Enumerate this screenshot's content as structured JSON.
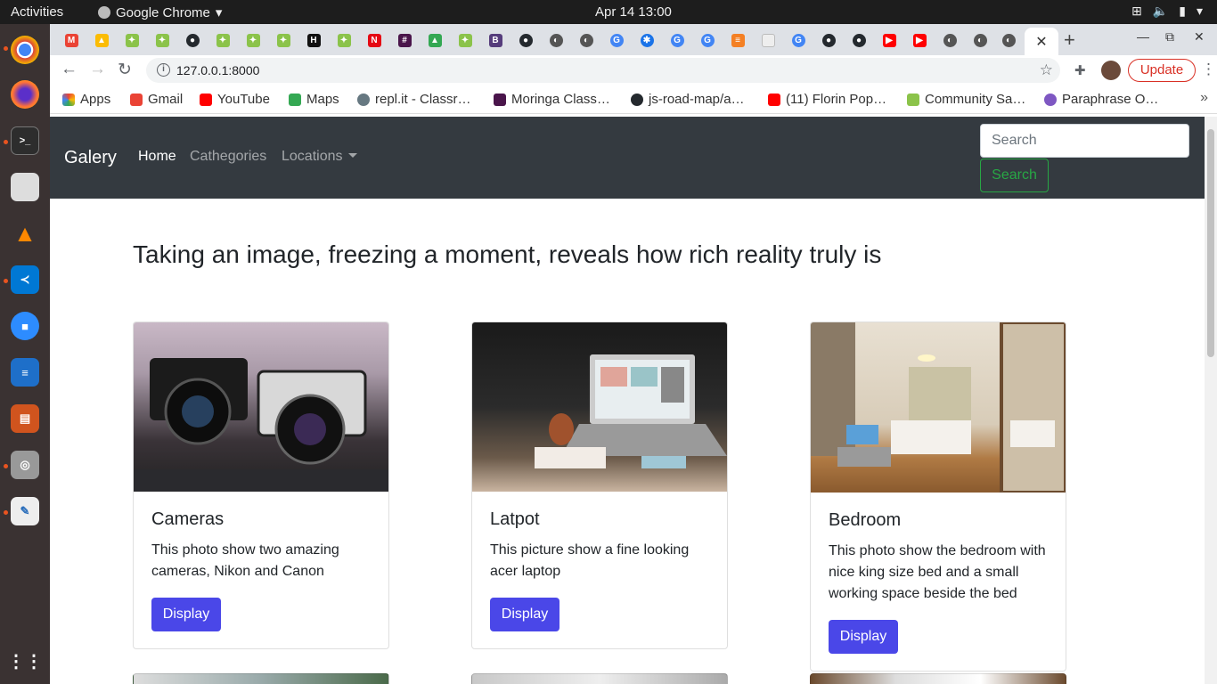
{
  "system": {
    "activities": "Activities",
    "app_name": "Google Chrome",
    "clock": "Apr 14  13:00"
  },
  "dock": {
    "apps": [
      "chrome-icon",
      "firefox-icon",
      "terminal-icon",
      "files-icon",
      "vlc-icon",
      "vscode-icon",
      "zoom-icon",
      "writer-icon",
      "impress-icon",
      "screenshot-icon",
      "text-editor-icon",
      "app-grid-icon"
    ]
  },
  "browser": {
    "url": "127.0.0.1:8000",
    "update_label": "Update",
    "new_tab": "+",
    "bookmarks": [
      {
        "label": "Apps",
        "color": "#e53935"
      },
      {
        "label": "Gmail",
        "color": "#ea4335"
      },
      {
        "label": "YouTube",
        "color": "#ff0000"
      },
      {
        "label": "Maps",
        "color": "#34a853"
      },
      {
        "label": "repl.it - Classr…",
        "color": "#667881"
      },
      {
        "label": "Moringa Class…",
        "color": "#4a154b"
      },
      {
        "label": "js-road-map/a…",
        "color": "#24292e"
      },
      {
        "label": "(11) Florin Pop…",
        "color": "#ff0000"
      },
      {
        "label": "Community Sa…",
        "color": "#8bc34a"
      },
      {
        "label": "Paraphrase O…",
        "color": "#7e57c2"
      }
    ],
    "more_bookmarks": "»"
  },
  "site": {
    "brand": "Galery",
    "nav": {
      "home": "Home",
      "categories": "Cathegories",
      "locations": "Locations"
    },
    "search": {
      "placeholder": "Search",
      "button": "Search"
    },
    "headline": "Taking an image, freezing a moment, reveals how rich reality truly is",
    "cards": [
      {
        "title": "Cameras",
        "text": "This photo show two amazing cameras, Nikon and Canon",
        "button": "Display"
      },
      {
        "title": "Latpot",
        "text": "This picture show a fine looking acer laptop",
        "button": "Display"
      },
      {
        "title": "Bedroom",
        "text": "This photo show the bedroom with nice king size bed and a small working space beside the bed",
        "button": "Display"
      }
    ]
  },
  "colors": {
    "navbar_bg": "#343a40",
    "primary_button": "#4a47e8",
    "success_outline": "#28a745"
  }
}
